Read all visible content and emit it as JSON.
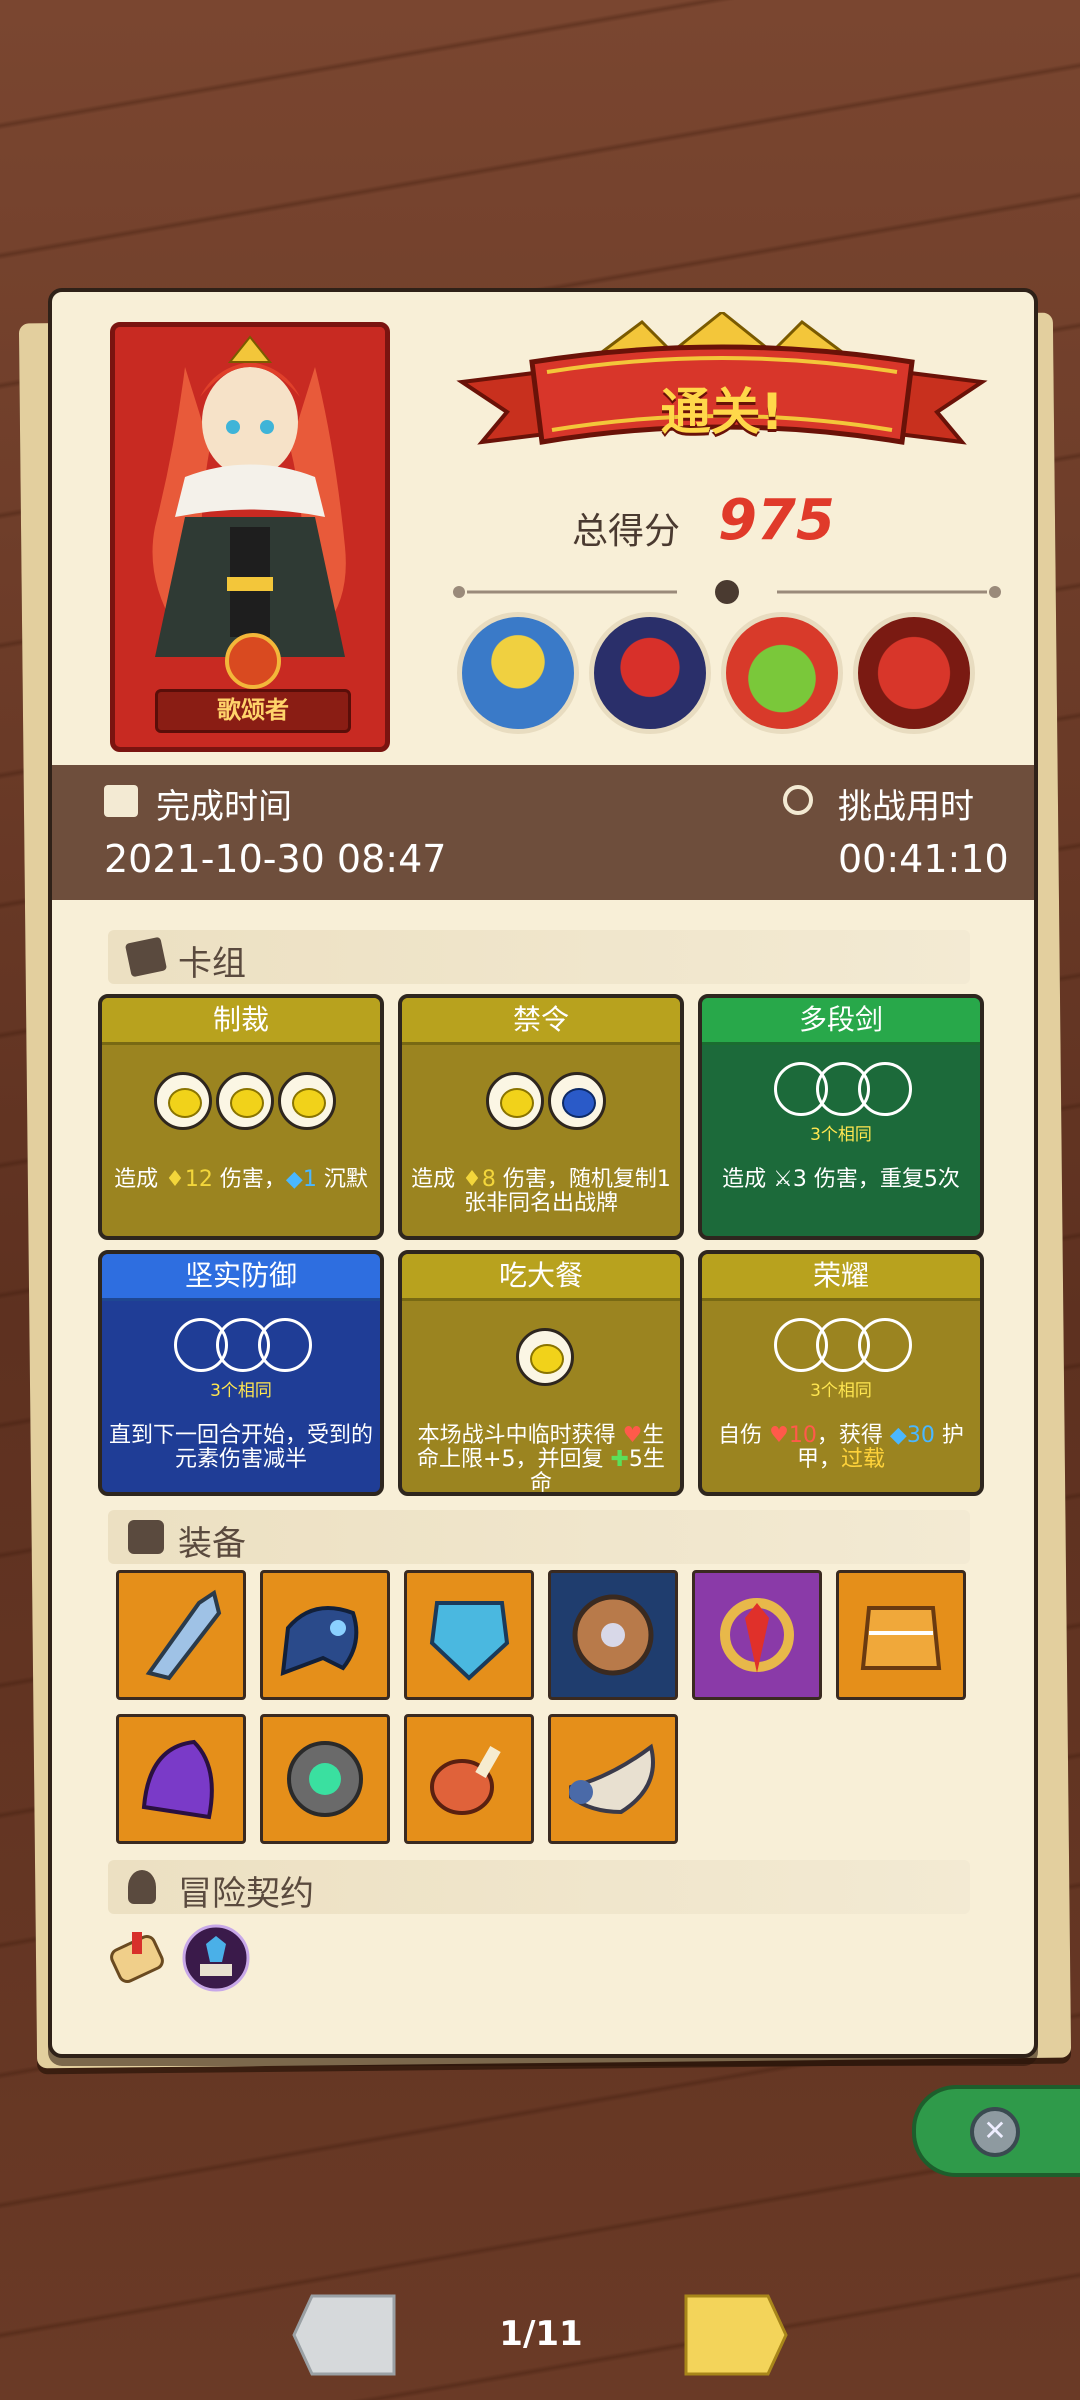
{
  "hero": {
    "name": "歌颂者"
  },
  "result": {
    "banner": "通关!",
    "score_label": "总得分",
    "score": "975"
  },
  "enemies": [
    "enemy-straw-hat",
    "enemy-cage-warrior",
    "enemy-green-ogre",
    "enemy-red-demon"
  ],
  "timebar": {
    "complete_label": "完成时间",
    "complete_value": "2021-10-30 08:47",
    "challenge_label": "挑战用时",
    "challenge_value": "00:41:10"
  },
  "deck": {
    "title": "卡组",
    "cards": [
      {
        "name": "制裁",
        "color": "#9b8420",
        "pre": "造成 ",
        "v1": "12",
        "mid": " 伤害，",
        "v2": "1",
        "post": " 沉默"
      },
      {
        "name": "禁令",
        "color": "#9b8420",
        "pre": "造成 ",
        "v1": "8",
        "post": " 伤害，随机复制1张非同名出战牌"
      },
      {
        "name": "多段剑",
        "color": "#1c6a3a",
        "same": "3个相同",
        "pre": "造成 ",
        "v1": "3",
        "post": " 伤害，重复5次"
      },
      {
        "name": "坚实防御",
        "color": "#1f3d96",
        "same": "3个相同",
        "text": "直到下一回合开始，受到的元素伤害减半"
      },
      {
        "name": "吃大餐",
        "color": "#9b8420",
        "pre": "本场战斗中临时获得 ",
        "v1": "",
        "mid": "生命上限+5，并回复 ",
        "v2": "5",
        "post": "生命"
      },
      {
        "name": "荣耀",
        "color": "#9b8420",
        "same": "3个相同",
        "pre": "自伤 ",
        "v1": "10",
        "mid": "，获得 ",
        "v2": "30",
        "post": " 护甲，",
        "extra": "过载"
      }
    ]
  },
  "equipment": {
    "title": "装备",
    "items": [
      "jagged-blade-icon",
      "plague-mask-icon",
      "crystal-shield-icon",
      "round-shield-icon",
      "ruby-ring-icon",
      "woven-cloak-icon",
      "purple-hood-icon",
      "spiral-relic-icon",
      "meat-leg-icon",
      "horn-icon"
    ]
  },
  "contract": {
    "title": "冒险契约",
    "items": [
      "scroll-icon",
      "crystal-book-icon"
    ]
  },
  "pager": {
    "page": "1/11"
  },
  "colors": {
    "red": "#e03a2a",
    "gold": "#9b8420",
    "green": "#1c6a3a",
    "blue": "#1f3d96",
    "paper": "#f8efd7",
    "bar": "#6e4e3c"
  }
}
